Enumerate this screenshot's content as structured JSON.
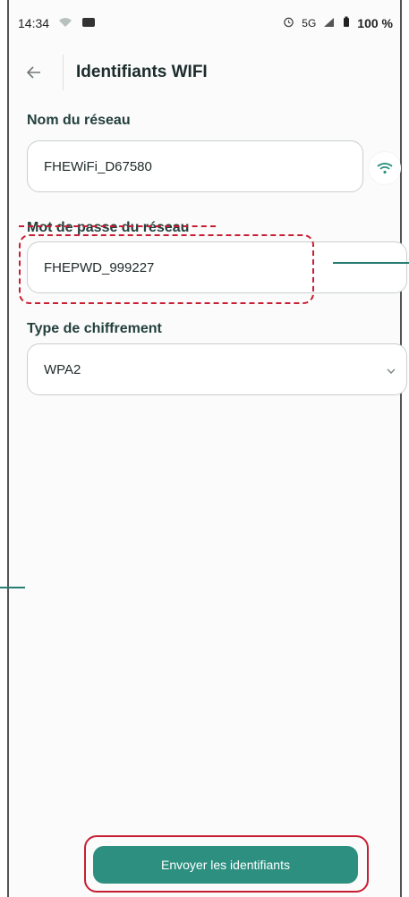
{
  "status_bar": {
    "time": "14:34",
    "network": "5G",
    "battery": "100 %"
  },
  "header": {
    "title": "Identifiants WIFI"
  },
  "form": {
    "ssid_label": "Nom du réseau",
    "ssid_value": "FHEWiFi_D67580",
    "password_label": "Mot de passe du réseau",
    "password_value": "FHEPWD_999227",
    "encryption_label": "Type de chiffrement",
    "encryption_value": "WPA2"
  },
  "actions": {
    "submit_label": "Envoyer les identifiants"
  },
  "colors": {
    "accent": "#2d8f80",
    "highlight": "#c81e34"
  }
}
